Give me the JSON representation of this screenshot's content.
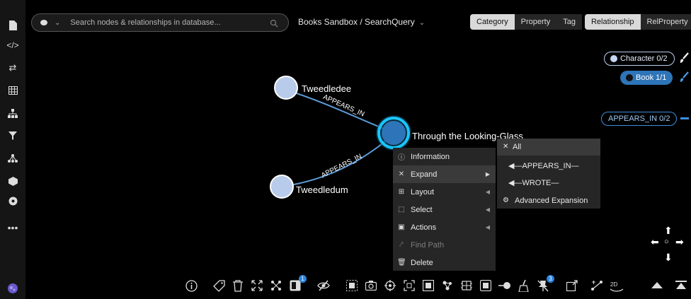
{
  "search": {
    "placeholder": "Search nodes & relationships in database..."
  },
  "breadcrumb": "Books Sandbox / SearchQuery",
  "view_tabs": [
    {
      "label": "Category",
      "active": true
    },
    {
      "label": "Property",
      "active": false
    },
    {
      "label": "Tag",
      "active": false
    },
    {
      "label": "Relationship",
      "active": true
    },
    {
      "label": "RelProperty",
      "active": false
    }
  ],
  "legend": {
    "character": "Character 0/2",
    "book": "Book 1/1",
    "relationship": "APPEARS_IN 0/2"
  },
  "graph": {
    "nodes": [
      {
        "label": "Tweedledee",
        "category": "Character"
      },
      {
        "label": "Tweedledum",
        "category": "Character"
      },
      {
        "label": "Through the Looking-Glass",
        "category": "Book",
        "selected": true
      }
    ],
    "edges": [
      {
        "label": "APPEARS_IN",
        "from": "Tweedledee",
        "to": "Through the Looking-Glass"
      },
      {
        "label": "APPEARS_IN",
        "from": "Tweedledum",
        "to": "Through the Looking-Glass"
      }
    ]
  },
  "context_menu": {
    "items": [
      {
        "label": "Information",
        "icon": "info-icon"
      },
      {
        "label": "Expand",
        "icon": "expand-icon",
        "highlighted": true
      },
      {
        "label": "Layout",
        "icon": "layout-icon"
      },
      {
        "label": "Select",
        "icon": "select-icon"
      },
      {
        "label": "Actions",
        "icon": "actions-icon"
      },
      {
        "label": "Find Path",
        "icon": "path-icon",
        "disabled": true
      },
      {
        "label": "Delete",
        "icon": "trash-icon"
      }
    ]
  },
  "expand_submenu": {
    "items": [
      "All",
      "◀—APPEARS_IN—",
      "◀—WROTE—",
      "Advanced Expansion"
    ]
  },
  "toolbar": {
    "badges": [
      "1",
      "3"
    ]
  },
  "colors": {
    "character_node": "#b8cbea",
    "book_node": "#2e74b8",
    "selection_ring": "#19c6ff",
    "edge": "#5a9ad6"
  }
}
